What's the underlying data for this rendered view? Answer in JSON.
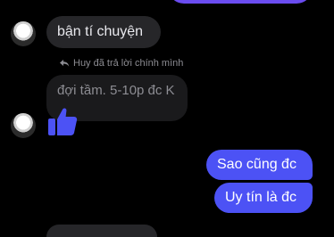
{
  "messages": {
    "received_1": "bận tí chuyện",
    "reply_notice": "Huy đã trả lời chính mình",
    "reply_quote": "đợi tầm. 5-10p đc K",
    "sent_1": "Sao cũng đc",
    "sent_2": "Uy tín là đc"
  },
  "icons": {
    "reply": "reply-arrow-icon",
    "thumb": "thumbs-up-icon"
  },
  "colors": {
    "sent_bubble": "#4c52f5",
    "received_bubble": "#262629",
    "thumb": "#4c52f5"
  }
}
